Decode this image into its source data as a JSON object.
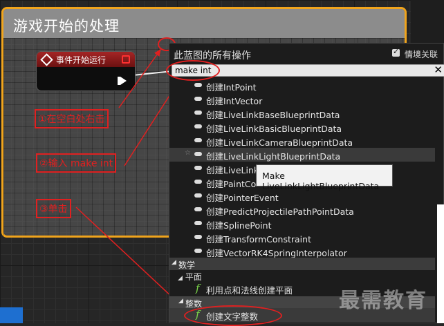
{
  "comment": {
    "title": "游戏开始的处理"
  },
  "event_node": {
    "title": "事件开始运行"
  },
  "annotations": {
    "step1": "①在空白处右击",
    "step2": "②输入 make int",
    "step3": "③单击"
  },
  "menu": {
    "title": "此蓝图的所有操作",
    "context_label": "情境关联",
    "search_value": "make int",
    "items": [
      "创建IntPoint",
      "创建IntVector",
      "创建LiveLinkBaseBlueprintData",
      "创建LiveLinkBasicBlueprintData",
      "创建LiveLinkCameraBlueprintData",
      "创建LiveLinkLightBlueprintData",
      "创建LiveLink",
      "创建PaintCo",
      "创建PointerEvent",
      "创建PredictProjectilePathPointData",
      "创建SplinePoint",
      "创建TransformConstraint",
      "创建VectorRK4SpringInterpolator"
    ],
    "cat_math": "数学",
    "sub_plane": "平面",
    "plane_item": "利用点和法线创建平面",
    "sub_int": "整数",
    "int_item": "创建文字整数"
  },
  "tooltip": "Make LiveLinkLightBlueprintData",
  "watermark": "最需教育",
  "colors": {
    "annotation_red": "#e02020",
    "comment_border": "#f0a41c",
    "function_green": "#7bd64a"
  }
}
